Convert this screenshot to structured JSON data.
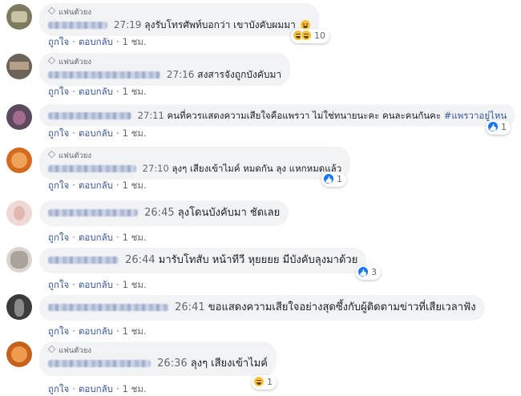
{
  "action_like": "ถูกใจ",
  "action_reply": "ตอบกลับ",
  "age": "1 ชม.",
  "fan_badge": "แฟนตัวยง",
  "comments": [
    {
      "time": "27:19",
      "text": "ลุงรับโทรศัพท์บอกว่า เขาบังคับผมมา",
      "reactions": [
        "haha",
        "haha"
      ],
      "count": "10",
      "blur": 74
    },
    {
      "time": "27:16",
      "text": "สงสารจังถูกบังคับมา",
      "reactions": [],
      "count": "",
      "blur": 140
    },
    {
      "time": "27:11",
      "text": "คนที่ควรแสดงความเสียใจคือแพรวา ไม่ใช่ทนายนะคะ คนละคนกันคะ",
      "hashtag": "#แพรวาอยู่ไหน",
      "reactions": [
        "like"
      ],
      "count": "1",
      "blur": 104
    },
    {
      "time": "27:10",
      "text": "ลุงๆ เสียงเข้าไมค์ หมดกัน ลุง แหกหมดแล้ว",
      "reactions": [
        "like"
      ],
      "count": "1",
      "blur": 110
    },
    {
      "time": "26:45",
      "text": "ลุงโดนบังคับมา ชัดเลย",
      "reactions": [],
      "count": "",
      "blur": 112
    },
    {
      "time": "26:44",
      "text": "มารับโทสับ หน้าทีวี หุยยยย มีบังคับลุงมาด้วย",
      "reactions": [
        "like"
      ],
      "count": "3",
      "blur": 88
    },
    {
      "time": "26:41",
      "text": "ขอแสดงความเสียใจอย่างสุดซึ้งกับผู้ติดตามข่าวที่เสียเวลาฟัง",
      "reactions": [],
      "count": "",
      "blur": 150
    },
    {
      "time": "26:36",
      "text": "ลุงๆ เสียงเข้าไมค์",
      "reactions": [
        "haha"
      ],
      "count": "1",
      "blur": 128
    }
  ]
}
